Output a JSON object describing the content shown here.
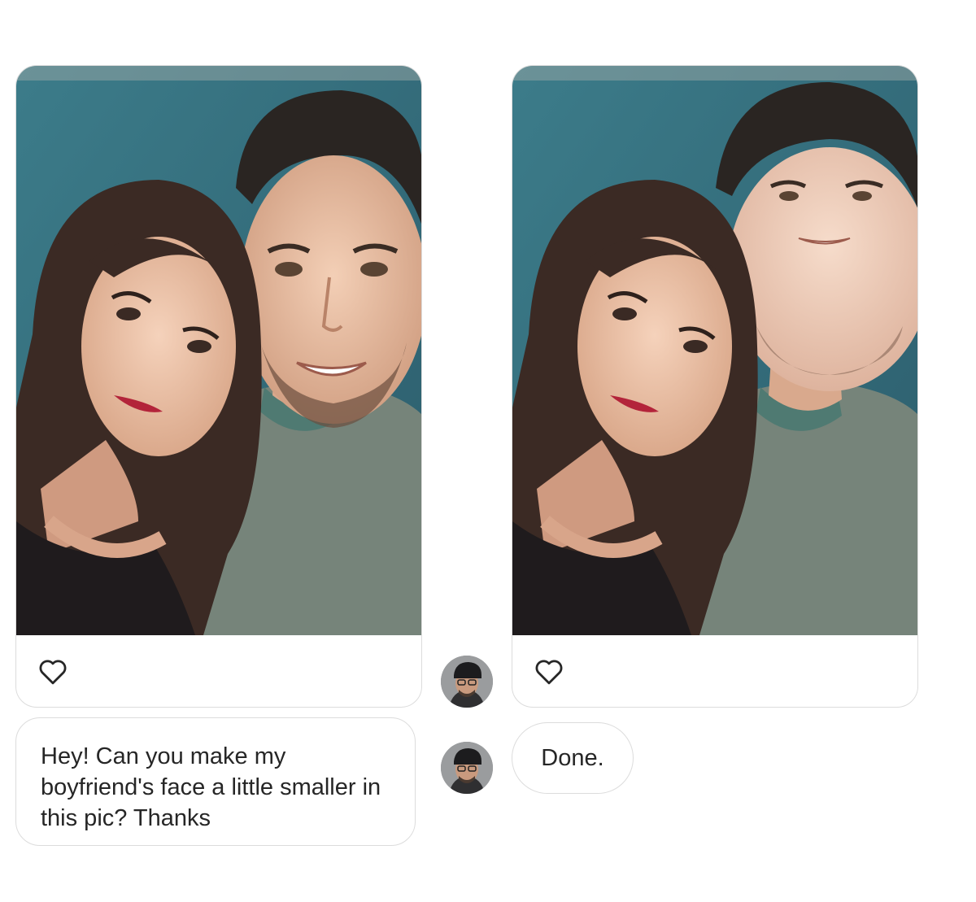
{
  "thread": {
    "request_message": {
      "text": "Hey! Can you make my boyfriend's face a little smaller in this pic? Thanks"
    },
    "reply_message": {
      "text": "Done."
    },
    "original_photo": {
      "alt": "selfie-original",
      "like_icon": "heart-outline-icon"
    },
    "edited_photo": {
      "alt": "selfie-edited",
      "like_icon": "heart-outline-icon"
    },
    "sender_avatar": {
      "icon": "user-avatar-with-cap-and-glasses"
    }
  },
  "colors": {
    "border": "#dcdcdc",
    "text": "#262626",
    "background": "#ffffff"
  }
}
